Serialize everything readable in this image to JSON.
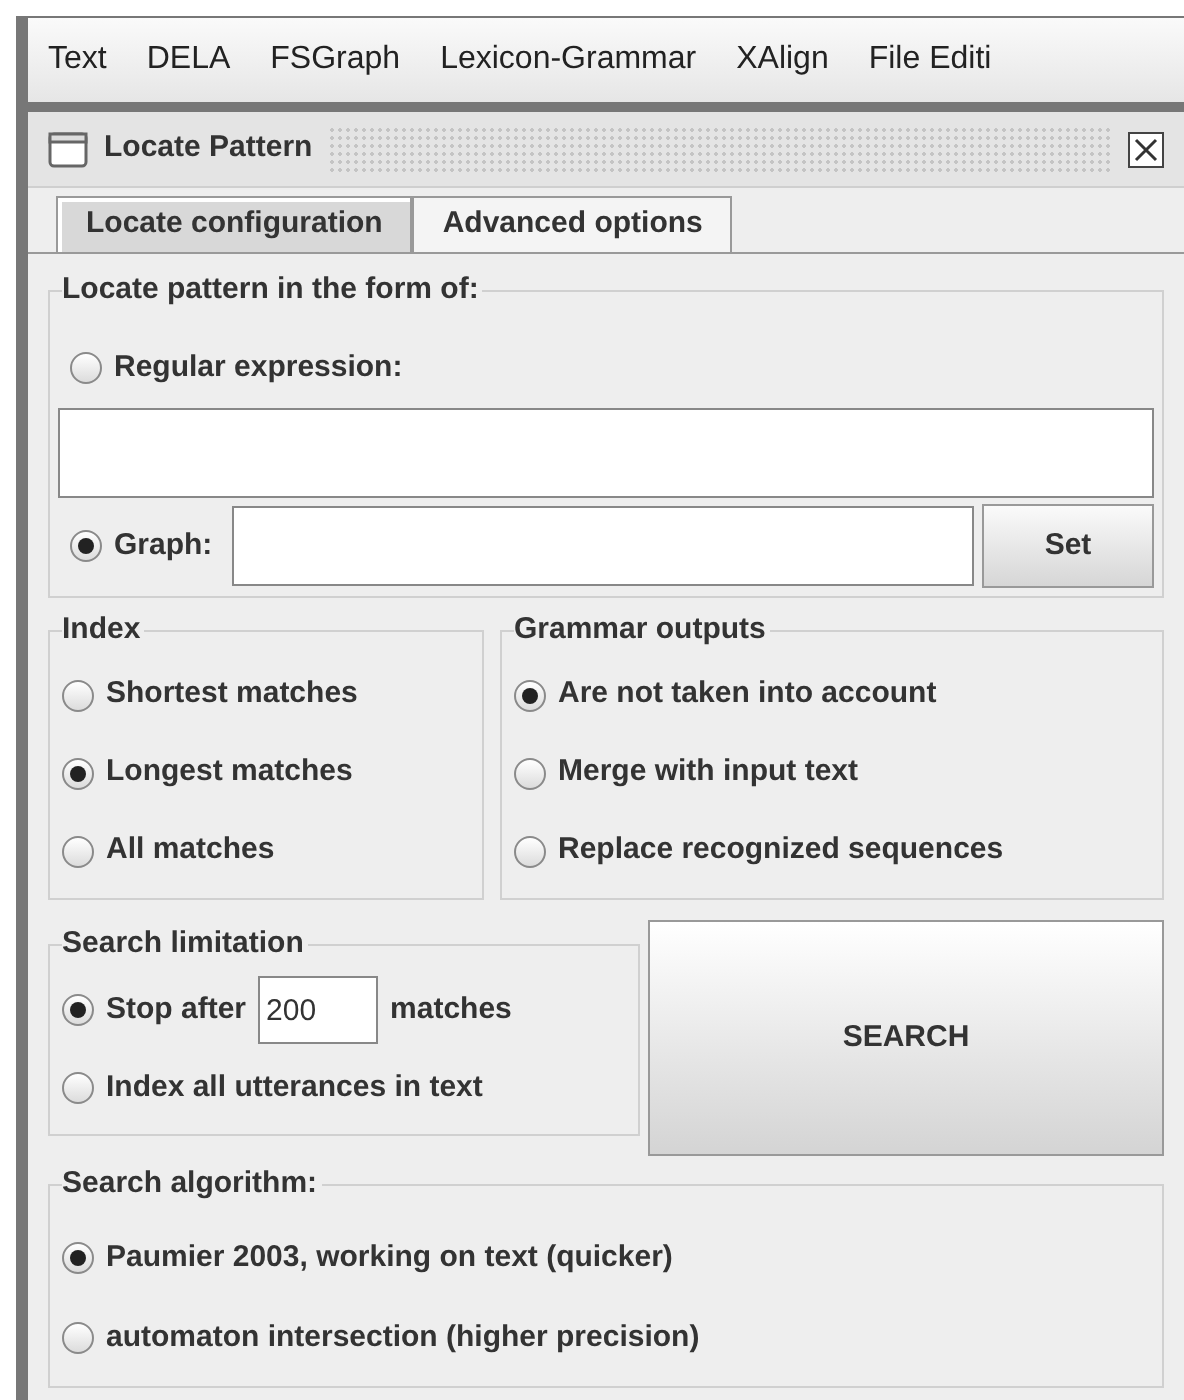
{
  "menu": [
    "Text",
    "DELA",
    "FSGraph",
    "Lexicon-Grammar",
    "XAlign",
    "File Editi"
  ],
  "window": {
    "title": "Locate Pattern"
  },
  "tabs": [
    {
      "label": "Locate configuration",
      "selected": true
    },
    {
      "label": "Advanced options",
      "selected": false
    }
  ],
  "pattern": {
    "title": "Locate pattern in the form of:",
    "regex": {
      "label": "Regular expression:",
      "selected": false
    },
    "graph": {
      "label": "Graph:",
      "selected": true
    },
    "set_button": "Set"
  },
  "index": {
    "title": "Index",
    "options": [
      {
        "label": "Shortest matches",
        "selected": false
      },
      {
        "label": "Longest matches",
        "selected": true
      },
      {
        "label": "All matches",
        "selected": false
      }
    ]
  },
  "grammar_outputs": {
    "title": "Grammar outputs",
    "options": [
      {
        "label": "Are not taken into account",
        "selected": true
      },
      {
        "label": "Merge with input text",
        "selected": false
      },
      {
        "label": "Replace recognized sequences",
        "selected": false
      }
    ]
  },
  "search_limitation": {
    "title": "Search limitation",
    "stop_after": {
      "label": "Stop after",
      "value": "200",
      "suffix": "matches",
      "selected": true
    },
    "index_all": {
      "label": "Index all utterances in text",
      "selected": false
    }
  },
  "search_button": "SEARCH",
  "search_algorithm": {
    "title": "Search algorithm:",
    "options": [
      {
        "label": "Paumier 2003, working on text (quicker)",
        "selected": true
      },
      {
        "label": "automaton intersection (higher precision)",
        "selected": false
      }
    ]
  }
}
